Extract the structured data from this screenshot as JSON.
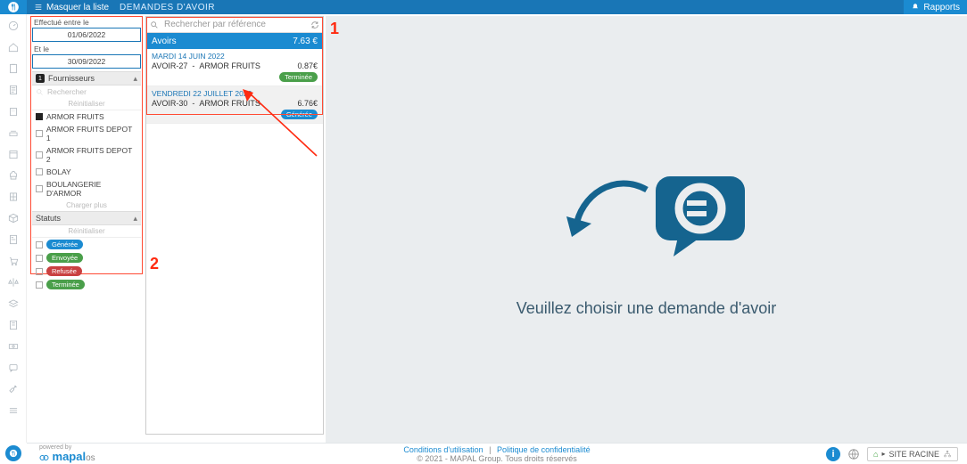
{
  "topbar": {
    "hide_list_label": "Masquer la liste",
    "page_title": "DEMANDES D'AVOIR",
    "rapports_label": "Rapports"
  },
  "filters": {
    "date_from_label": "Effectué entre le",
    "date_from_value": "01/06/2022",
    "date_to_label": "Et le",
    "date_to_value": "30/09/2022",
    "suppliers_section": "Fournisseurs",
    "suppliers_badge": "1",
    "search_placeholder": "Rechercher",
    "reset_label": "Réinitialiser",
    "suppliers": [
      {
        "name": "ARMOR FRUITS",
        "checked": true
      },
      {
        "name": "ARMOR FRUITS DEPOT 1",
        "checked": false
      },
      {
        "name": "ARMOR FRUITS DEPOT 2",
        "checked": false
      },
      {
        "name": "BOLAY",
        "checked": false
      },
      {
        "name": "BOULANGERIE D'ARMOR",
        "checked": false
      }
    ],
    "load_more": "Charger plus",
    "status_section": "Statuts",
    "status_reset": "Réinitialiser",
    "statuses": [
      {
        "label": "Générée",
        "cls": "blue"
      },
      {
        "label": "Envoyée",
        "cls": "green"
      },
      {
        "label": "Refusée",
        "cls": "red"
      },
      {
        "label": "Terminée",
        "cls": "green"
      }
    ]
  },
  "list": {
    "search_placeholder": "Rechercher par référence",
    "head_label": "Avoirs",
    "head_total": "7.63 €",
    "groups": [
      {
        "date": "MARDI 14 JUIN 2022",
        "ref": "AVOIR-27",
        "supplier": "ARMOR FRUITS",
        "amount": "0.87€",
        "status": {
          "label": "Terminée",
          "cls": "green"
        },
        "selected": false
      },
      {
        "date": "VENDREDI 22 JUILLET 2022",
        "ref": "AVOIR-30",
        "supplier": "ARMOR FRUITS",
        "amount": "6.76€",
        "status": {
          "label": "Générée",
          "cls": "blue"
        },
        "selected": true
      }
    ]
  },
  "main": {
    "empty_message": "Veuillez choisir une demande d'avoir"
  },
  "footer": {
    "powered_by": "powered by",
    "brand": "mapal",
    "brand_suffix": "os",
    "terms": "Conditions d'utilisation",
    "sep": "|",
    "privacy": "Politique de confidentialité",
    "copyright": "© 2021 - MAPAL Group. Tous droits réservés",
    "site_label": "SITE RACINE"
  },
  "annotations": {
    "one": "1",
    "two": "2"
  }
}
